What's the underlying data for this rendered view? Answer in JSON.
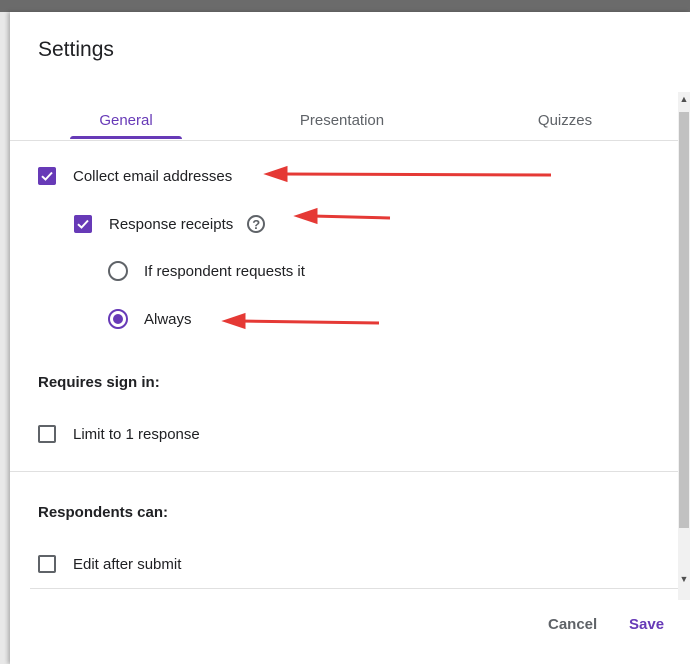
{
  "dialog": {
    "title": "Settings"
  },
  "tabs": [
    {
      "label": "General",
      "active": true
    },
    {
      "label": "Presentation",
      "active": false
    },
    {
      "label": "Quizzes",
      "active": false
    }
  ],
  "general": {
    "collect_email": {
      "label": "Collect email addresses",
      "checked": true
    },
    "response_receipts": {
      "label": "Response receipts",
      "checked": true,
      "help_glyph": "?"
    },
    "receipt_options": [
      {
        "label": "If respondent requests it",
        "selected": false
      },
      {
        "label": "Always",
        "selected": true
      }
    ],
    "requires_sign_in": {
      "title": "Requires sign in:",
      "limit_one": {
        "label": "Limit to 1 response",
        "checked": false
      }
    },
    "respondents_can": {
      "title": "Respondents can:",
      "edit_after_submit": {
        "label": "Edit after submit",
        "checked": false
      }
    }
  },
  "footer": {
    "cancel_label": "Cancel",
    "save_label": "Save"
  },
  "colors": {
    "accent": "#673ab7",
    "annotation_arrow": "#e53935"
  }
}
